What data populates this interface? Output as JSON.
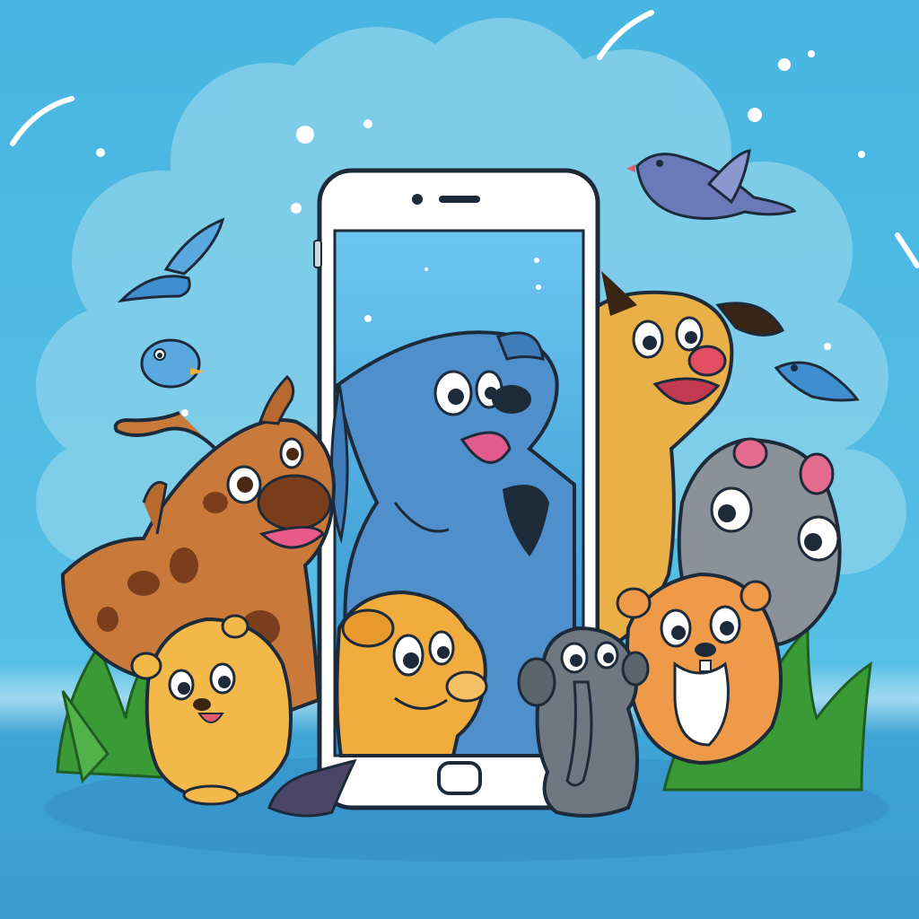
{
  "scene": {
    "subject": "cartoon-animals-around-smartphone",
    "icons": [
      "phone-icon",
      "dog-icon",
      "bird-icon",
      "giraffe-icon",
      "hamster-icon",
      "hippo-icon",
      "beaver-icon",
      "elephant-icon",
      "puppy-icon"
    ]
  },
  "colors": {
    "background_top": "#4bb3de",
    "background_bottom": "#3ea2d4",
    "cloud": "#8fd3ea",
    "phone_body": "#ffffff",
    "phone_screen": "#6ec6ef",
    "blue_dog": "#4f8fcb",
    "giraffe": "#c77a3a",
    "hamster": "#f2b544",
    "orange_dog": "#e8b24a",
    "hippo": "#8a9097",
    "beaver": "#ee9a48",
    "elephant": "#6f7780",
    "grass": "#3f9f3a",
    "bird": "#6a79b8"
  }
}
